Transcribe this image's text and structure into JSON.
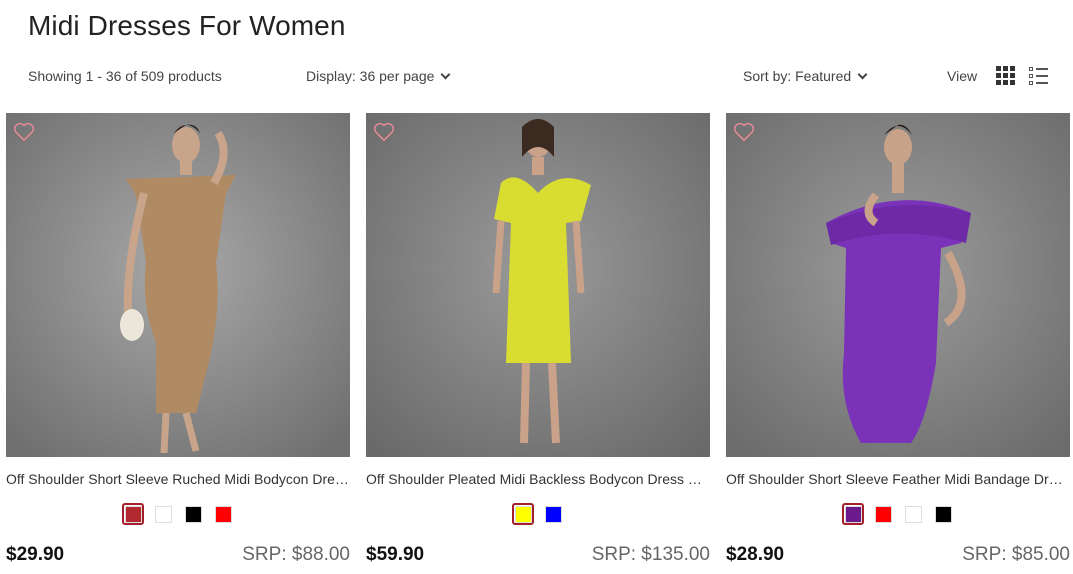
{
  "page": {
    "title": "Midi Dresses For Women"
  },
  "toolbar": {
    "count_text": "Showing 1 - 36 of 509 products",
    "per_page_label": "Display: 36 per page",
    "sort_label": "Sort by: Featured",
    "view_label": "View"
  },
  "products": [
    {
      "title": "Off Shoulder Short Sleeve Ruched Midi Bodycon Dres...",
      "price": "$29.90",
      "srp": "SRP: $88.00",
      "dress_color": "#b08a63",
      "swatches": [
        "#b3282e",
        "#ffffff",
        "#000000",
        "#ff0000"
      ],
      "selected_swatch": 0
    },
    {
      "title": "Off Shoulder Pleated Midi Backless Bodycon Dress HL...",
      "price": "$59.90",
      "srp": "SRP: $135.00",
      "dress_color": "#d9dd32",
      "swatches": [
        "#ffff00",
        "#0000ff"
      ],
      "selected_swatch": 0
    },
    {
      "title": "Off Shoulder Short Sleeve Feather Midi Bandage Dres...",
      "price": "$28.90",
      "srp": "SRP: $85.00",
      "dress_color": "#6e2aa6",
      "swatches": [
        "#6a1a8a",
        "#ff0000",
        "#ffffff",
        "#000000"
      ],
      "selected_swatch": 0
    }
  ]
}
